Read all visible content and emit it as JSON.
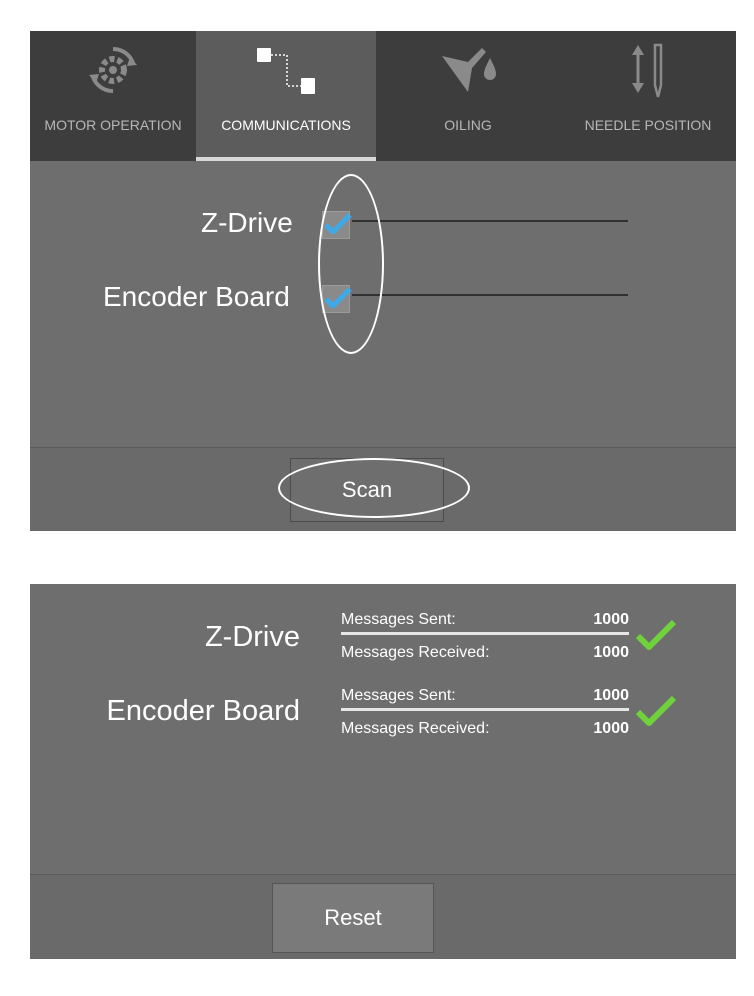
{
  "tabs": [
    {
      "label": "MOTOR OPERATION",
      "icon": "gear-refresh-icon",
      "active": false
    },
    {
      "label": "COMMUNICATIONS",
      "icon": "network-nodes-icon",
      "active": true
    },
    {
      "label": "OILING",
      "icon": "oil-drop-icon",
      "active": false
    },
    {
      "label": "NEEDLE POSITION",
      "icon": "needle-arrows-icon",
      "active": false
    }
  ],
  "scan_screen": {
    "devices": [
      {
        "label": "Z-Drive",
        "checked": true
      },
      {
        "label": "Encoder Board",
        "checked": true
      }
    ],
    "scan_button": "Scan"
  },
  "results_screen": {
    "devices": [
      {
        "label": "Z-Drive",
        "sent_label": "Messages Sent:",
        "sent_value": "1000",
        "received_label": "Messages Received:",
        "received_value": "1000",
        "ok": true
      },
      {
        "label": "Encoder Board",
        "sent_label": "Messages Sent:",
        "sent_value": "1000",
        "received_label": "Messages Received:",
        "received_value": "1000",
        "ok": true
      }
    ],
    "reset_button": "Reset"
  },
  "colors": {
    "panel_bg": "#6e6e6e",
    "tabbar_bg": "#3d3d3d",
    "checkbox_check": "#3fa9e8",
    "status_ok": "#6fd13c"
  }
}
